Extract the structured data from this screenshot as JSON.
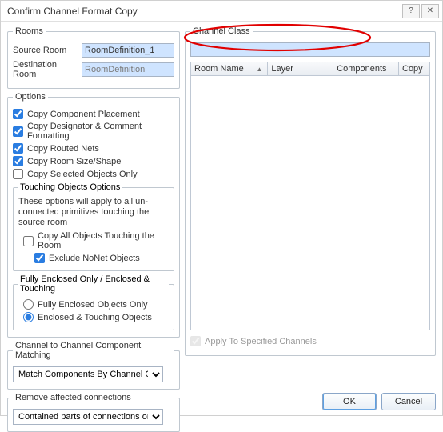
{
  "window": {
    "title": "Confirm Channel Format Copy",
    "help_icon": "?",
    "close_icon": "✕"
  },
  "rooms": {
    "legend": "Rooms",
    "source_label": "Source Room",
    "source_value": "RoomDefinition_1",
    "dest_label": "Destination Room",
    "dest_value": "RoomDefinition"
  },
  "options": {
    "legend": "Options",
    "copy_component_placement": "Copy Component Placement",
    "copy_designator_comment": "Copy Designator & Comment Formatting",
    "copy_routed_nets": "Copy Routed Nets",
    "copy_room_size": "Copy Room Size/Shape",
    "copy_selected_only": "Copy Selected Objects Only",
    "touching": {
      "legend": "Touching Objects Options",
      "desc": "These options will apply to all un-connected primitives touching the source room",
      "copy_all_touching": "Copy All Objects Touching the Room",
      "exclude_nonet": "Exclude NoNet Objects"
    },
    "enclosed": {
      "legend": "Fully Enclosed Only / Enclosed & Touching",
      "opt_full": "Fully Enclosed Objects Only",
      "opt_touch": "Enclosed & Touching Objects"
    }
  },
  "matching": {
    "legend": "Channel to Channel Component Matching",
    "selected": "Match Components By Channel Offsets"
  },
  "remove": {
    "legend": "Remove affected connections",
    "selected": "Contained parts of connections only"
  },
  "channel_class": {
    "legend": "Channel Class",
    "columns": {
      "room_name": "Room Name",
      "layer": "Layer",
      "components": "Components",
      "copy": "Copy"
    }
  },
  "apply_label": "Apply To Specified Channels",
  "buttons": {
    "ok": "OK",
    "cancel": "Cancel"
  }
}
